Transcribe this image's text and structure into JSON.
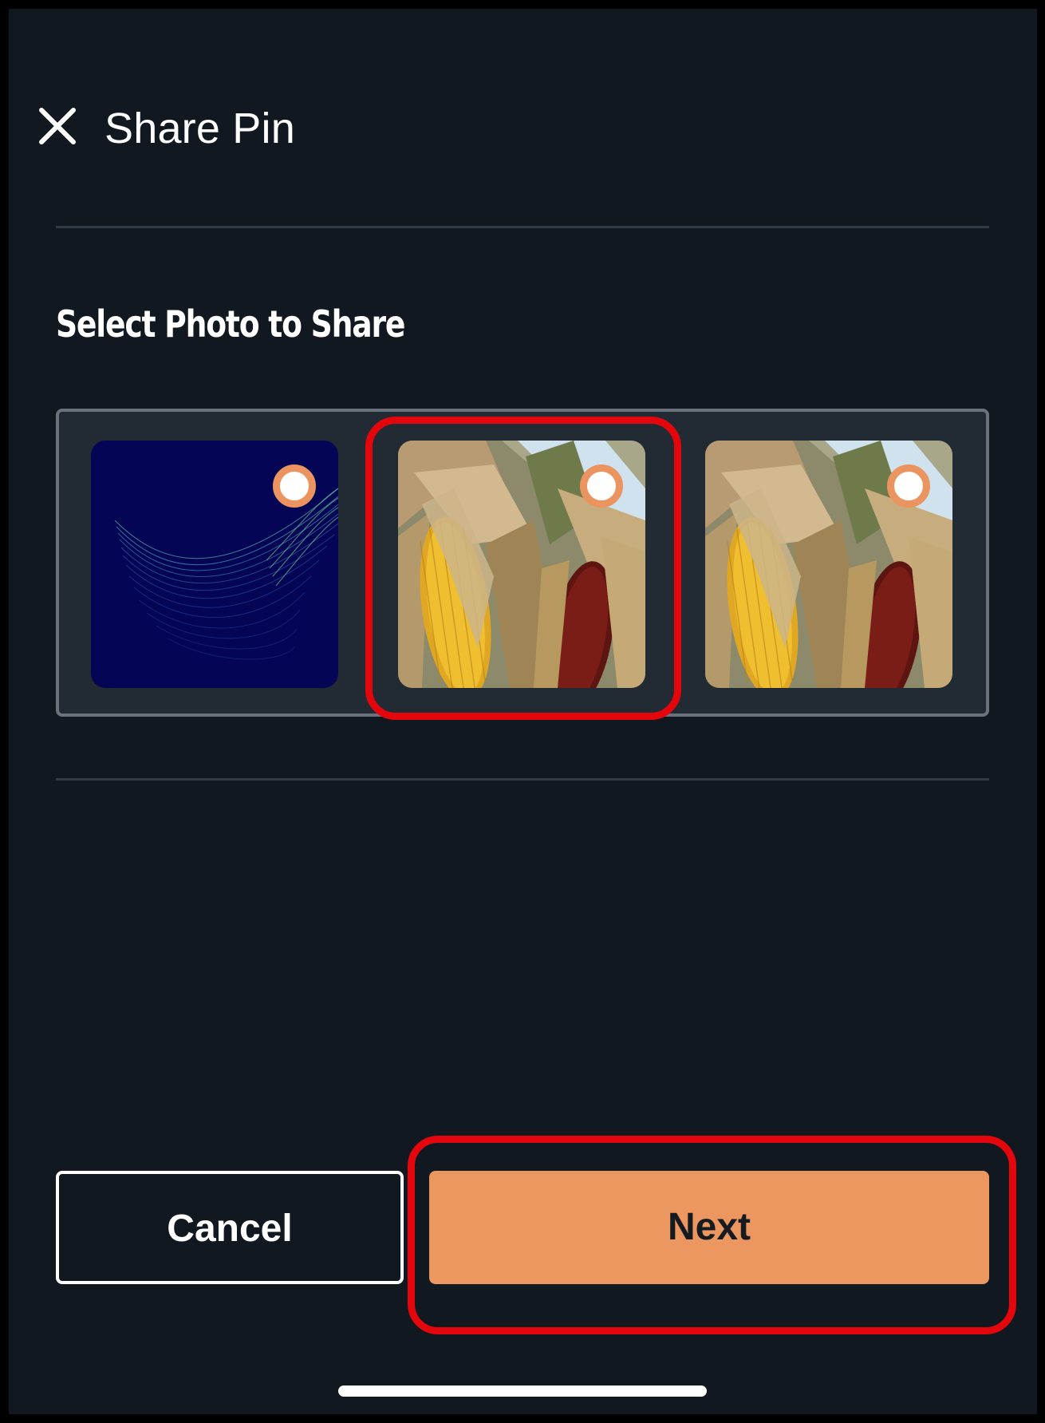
{
  "header": {
    "title": "Share Pin",
    "close_icon": "close-icon"
  },
  "section": {
    "title": "Select Photo to Share"
  },
  "photos": [
    {
      "name": "abstract-wave-photo",
      "selected": false
    },
    {
      "name": "corn-photo",
      "selected": false,
      "highlighted": true
    },
    {
      "name": "corn-photo",
      "selected": false
    }
  ],
  "actions": {
    "cancel_label": "Cancel",
    "next_label": "Next"
  },
  "colors": {
    "background": "#111820",
    "accent": "#ec975f",
    "highlight": "#e4060d",
    "carousel_bg": "#222b34"
  }
}
